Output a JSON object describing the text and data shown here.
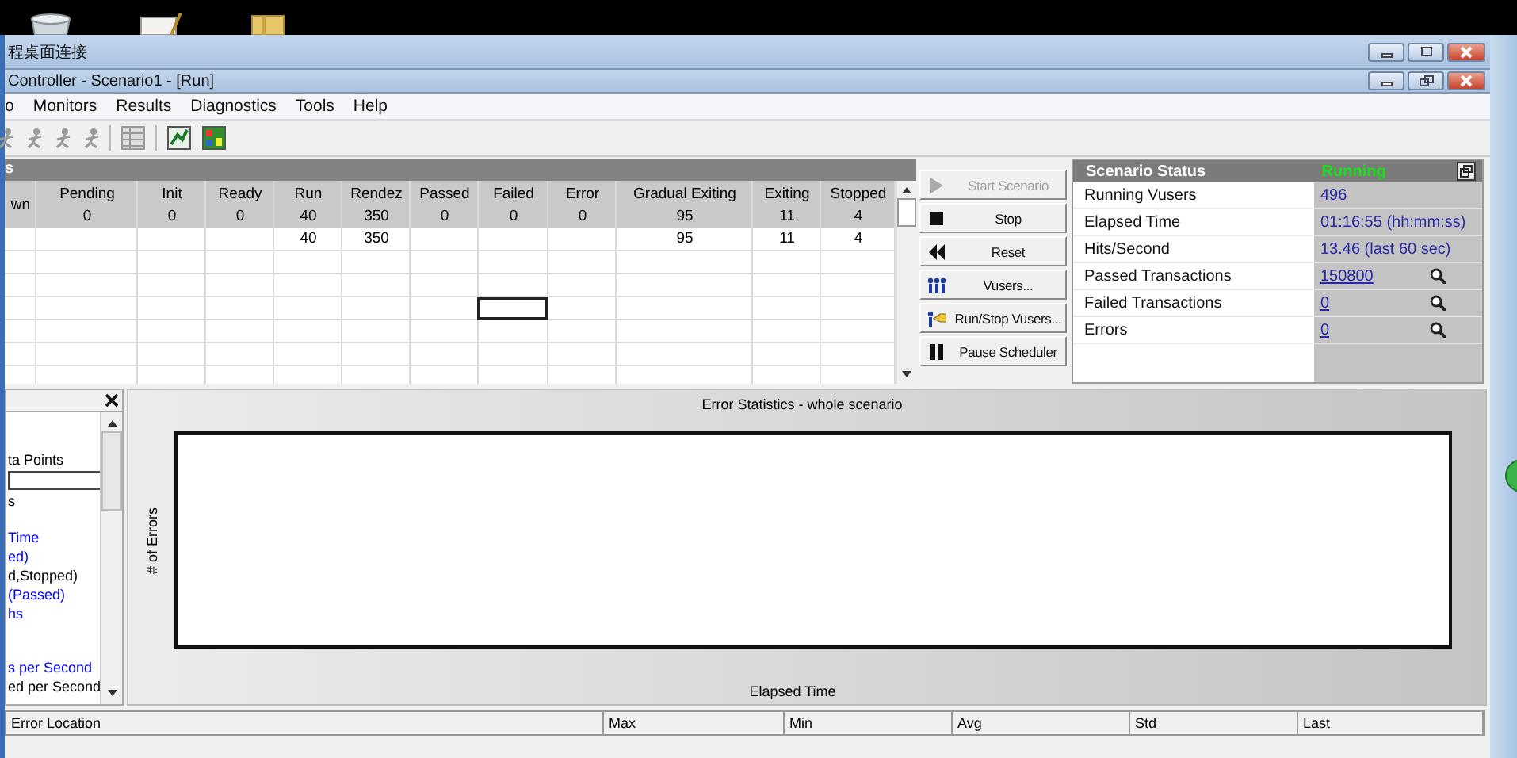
{
  "remote_window": {
    "title": "程桌面连接"
  },
  "window": {
    "title": "Controller - Scenario1 - [Run]"
  },
  "menu": [
    "o",
    "Monitors",
    "Results",
    "Diagnostics",
    "Tools",
    "Help"
  ],
  "groups_panel": {
    "title": "s",
    "columns": [
      {
        "label": "wn"
      },
      {
        "label": "Pending",
        "total": "0"
      },
      {
        "label": "Init",
        "total": "0"
      },
      {
        "label": "Ready",
        "total": "0"
      },
      {
        "label": "Run",
        "total": "40"
      },
      {
        "label": "Rendez",
        "total": "350"
      },
      {
        "label": "Passed",
        "total": "0"
      },
      {
        "label": "Failed",
        "total": "0"
      },
      {
        "label": "Error",
        "total": "0"
      },
      {
        "label": "Gradual Exiting",
        "total": "95"
      },
      {
        "label": "Exiting",
        "total": "11"
      },
      {
        "label": "Stopped",
        "total": "4"
      }
    ],
    "rows": [
      [
        null,
        null,
        null,
        null,
        "40",
        "350",
        null,
        null,
        null,
        "95",
        "11",
        "4"
      ],
      [
        null,
        null,
        null,
        null,
        null,
        null,
        null,
        null,
        null,
        null,
        null,
        null
      ],
      [
        null,
        null,
        null,
        null,
        null,
        null,
        null,
        null,
        null,
        null,
        null,
        null
      ],
      [
        null,
        null,
        null,
        null,
        null,
        null,
        null,
        {
          "focused": true
        },
        null,
        null,
        null,
        null
      ],
      [
        null,
        null,
        null,
        null,
        null,
        null,
        null,
        null,
        null,
        null,
        null,
        null
      ],
      [
        null,
        null,
        null,
        null,
        null,
        null,
        null,
        null,
        null,
        null,
        null,
        null
      ]
    ]
  },
  "control_buttons": [
    {
      "label": "Start Scenario",
      "disabled": true
    },
    {
      "label": "Stop",
      "disabled": false
    },
    {
      "label": "Reset",
      "disabled": false
    },
    {
      "label": "Vusers...",
      "disabled": false
    },
    {
      "label": "Run/Stop Vusers...",
      "disabled": false
    },
    {
      "label": "Pause Scheduler",
      "disabled": false
    }
  ],
  "scenario_status": {
    "title": "Scenario Status",
    "state": "Running",
    "rows": [
      {
        "label": "Running Vusers",
        "value": "496",
        "link": false,
        "search": false
      },
      {
        "label": "Elapsed Time",
        "value": "01:16:55 (hh:mm:ss)",
        "link": false,
        "search": false
      },
      {
        "label": "Hits/Second",
        "value": "13.46 (last 60 sec)",
        "link": false,
        "search": false
      },
      {
        "label": "Passed Transactions",
        "value": "150800",
        "link": true,
        "search": true
      },
      {
        "label": "Failed Transactions",
        "value": "0",
        "link": true,
        "search": true
      },
      {
        "label": "Errors",
        "value": "0",
        "link": true,
        "search": true
      }
    ]
  },
  "graph_tree": {
    "groups": [
      {
        "items": [
          {
            "kind": "text",
            "text": "ta Points",
            "color": "#000000"
          },
          {
            "kind": "field"
          },
          {
            "kind": "text",
            "text": "s",
            "color": "#000000"
          }
        ]
      },
      {
        "items": [
          {
            "kind": "text",
            "text": "Time",
            "color": "#0000ff"
          },
          {
            "kind": "text",
            "text": "ed)",
            "color": "#0000ff"
          },
          {
            "kind": "text",
            "text": "d,Stopped)",
            "color": "#000000"
          },
          {
            "kind": "text",
            "text": "(Passed)",
            "color": "#0000ff"
          },
          {
            "kind": "text",
            "text": "hs",
            "color": "#0000ff"
          }
        ]
      },
      {
        "items": [
          {
            "kind": "text",
            "text": "s per Second",
            "color": "#0000ff"
          },
          {
            "kind": "text",
            "text": "ed per Second",
            "color": "#000000"
          }
        ]
      }
    ]
  },
  "graph": {
    "title": "Error Statistics - whole scenario",
    "ylabel": "# of Errors",
    "xlabel": "Elapsed Time"
  },
  "measurements_table": {
    "columns": [
      "Error Location",
      "Max",
      "Min",
      "Avg",
      "Std",
      "Last"
    ]
  }
}
